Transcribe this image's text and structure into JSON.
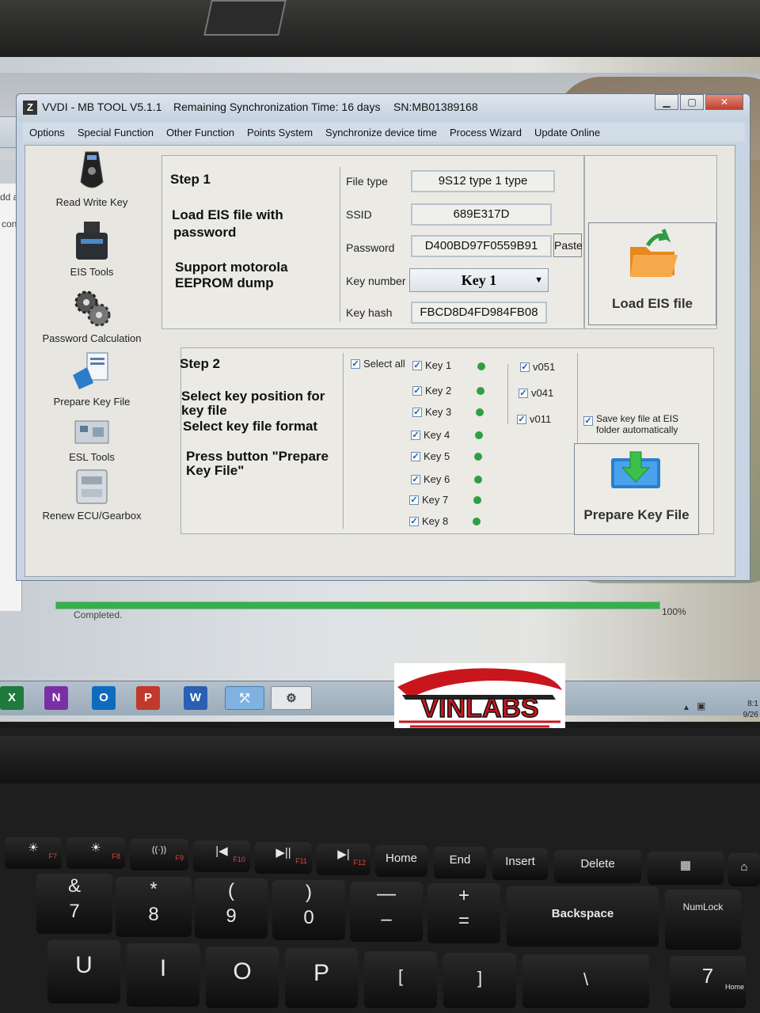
{
  "app": {
    "title": "VVDI - MB TOOL V5.1.1",
    "sync_time": "Remaining Synchronization Time: 16 days",
    "serial": "SN:MB01389168"
  },
  "window_controls": {
    "minimize": "▁",
    "maximize": "▢",
    "close": "✕"
  },
  "menu": [
    "Options",
    "Special Function",
    "Other Function",
    "Points System",
    "Synchronize device time",
    "Process Wizard",
    "Update Online"
  ],
  "background_window": {
    "text_1": "dd a",
    "text_2": "cont"
  },
  "tools": [
    {
      "label": "Read Write Key",
      "icon": "car-key-icon"
    },
    {
      "label": "EIS Tools",
      "icon": "eis-module-icon"
    },
    {
      "label": "Password Calculation",
      "icon": "gears-icon"
    },
    {
      "label": "Prepare Key File",
      "icon": "key-file-icon"
    },
    {
      "label": "ESL Tools",
      "icon": "esl-board-icon"
    },
    {
      "label": "Renew ECU/Gearbox",
      "icon": "ecu-icon"
    }
  ],
  "step1": {
    "title": "Step 1",
    "desc_1": "Load EIS file with",
    "desc_2": "password",
    "desc_3": "Support motorola",
    "desc_4": "EEPROM dump",
    "file_type_label": "File type",
    "file_type": "9S12 type 1 type",
    "ssid_label": "SSID",
    "ssid": "689E317D",
    "password_label": "Password",
    "password": "D400BD97F0559B91",
    "paste_label": "Paste",
    "key_number_label": "Key number",
    "key_number": "Key 1",
    "key_hash_label": "Key hash",
    "key_hash": "FBCD8D4FD984FB08",
    "load_button": "Load EIS file"
  },
  "step2": {
    "title": "Step 2",
    "desc_1": "Select key position for",
    "desc_2": "key file",
    "desc_3": "Select key file format",
    "desc_4": "Press button \"Prepare",
    "desc_5": "Key File\"",
    "select_all": "Select all",
    "keys": [
      "Key 1",
      "Key 2",
      "Key 3",
      "Key 4",
      "Key 5",
      "Key 6",
      "Key 7",
      "Key 8"
    ],
    "formats": [
      "v051",
      "v041",
      "v011"
    ],
    "save_auto_1": "Save key file at EIS",
    "save_auto_2": "folder automatically",
    "prepare_button": "Prepare Key File"
  },
  "status": {
    "text": "Completed.",
    "progress_label": "100%",
    "progress": 1.0
  },
  "taskbar": {
    "apps": [
      {
        "letter": "X",
        "color": "#1f7a3d",
        "name": "excel-icon"
      },
      {
        "letter": "N",
        "color": "#7b2fa5",
        "name": "onenote-icon"
      },
      {
        "letter": "O",
        "color": "#0f6cbd",
        "name": "outlook-icon"
      },
      {
        "letter": "P",
        "color": "#c0392b",
        "name": "powerpoint-icon"
      },
      {
        "letter": "W",
        "color": "#2b5fb3",
        "name": "word-icon"
      }
    ],
    "clock_1": "8:1",
    "clock_2": "9/26"
  },
  "watermark": "VINLABS",
  "keyboard": {
    "fkeys": [
      {
        "label": "☀",
        "sub": "F7"
      },
      {
        "label": "☀",
        "sub": "F8"
      },
      {
        "label": "((·))",
        "sub": "F9"
      },
      {
        "label": "|◀",
        "sub": "F10"
      },
      {
        "label": "▶||",
        "sub": "F11"
      },
      {
        "label": "▶|",
        "sub": "F12"
      },
      {
        "label": "Home",
        "sub": ""
      },
      {
        "label": "End",
        "sub": ""
      },
      {
        "label": "Insert",
        "sub": ""
      },
      {
        "label": "Delete",
        "sub": ""
      }
    ],
    "numrow": [
      {
        "top": "&",
        "bottom": "7"
      },
      {
        "top": "*",
        "bottom": "8"
      },
      {
        "top": "(",
        "bottom": "9"
      },
      {
        "top": ")",
        "bottom": "0"
      },
      {
        "top": "—",
        "bottom": "–"
      },
      {
        "top": "+",
        "bottom": "="
      }
    ],
    "backspace": "Backspace",
    "numlock": "NumLock",
    "letters": [
      "U",
      "I",
      "O",
      "P"
    ],
    "bracket_open": "[",
    "bracket_close": "]",
    "backslash": "\\",
    "num7": "7",
    "home_pad": "Home"
  }
}
